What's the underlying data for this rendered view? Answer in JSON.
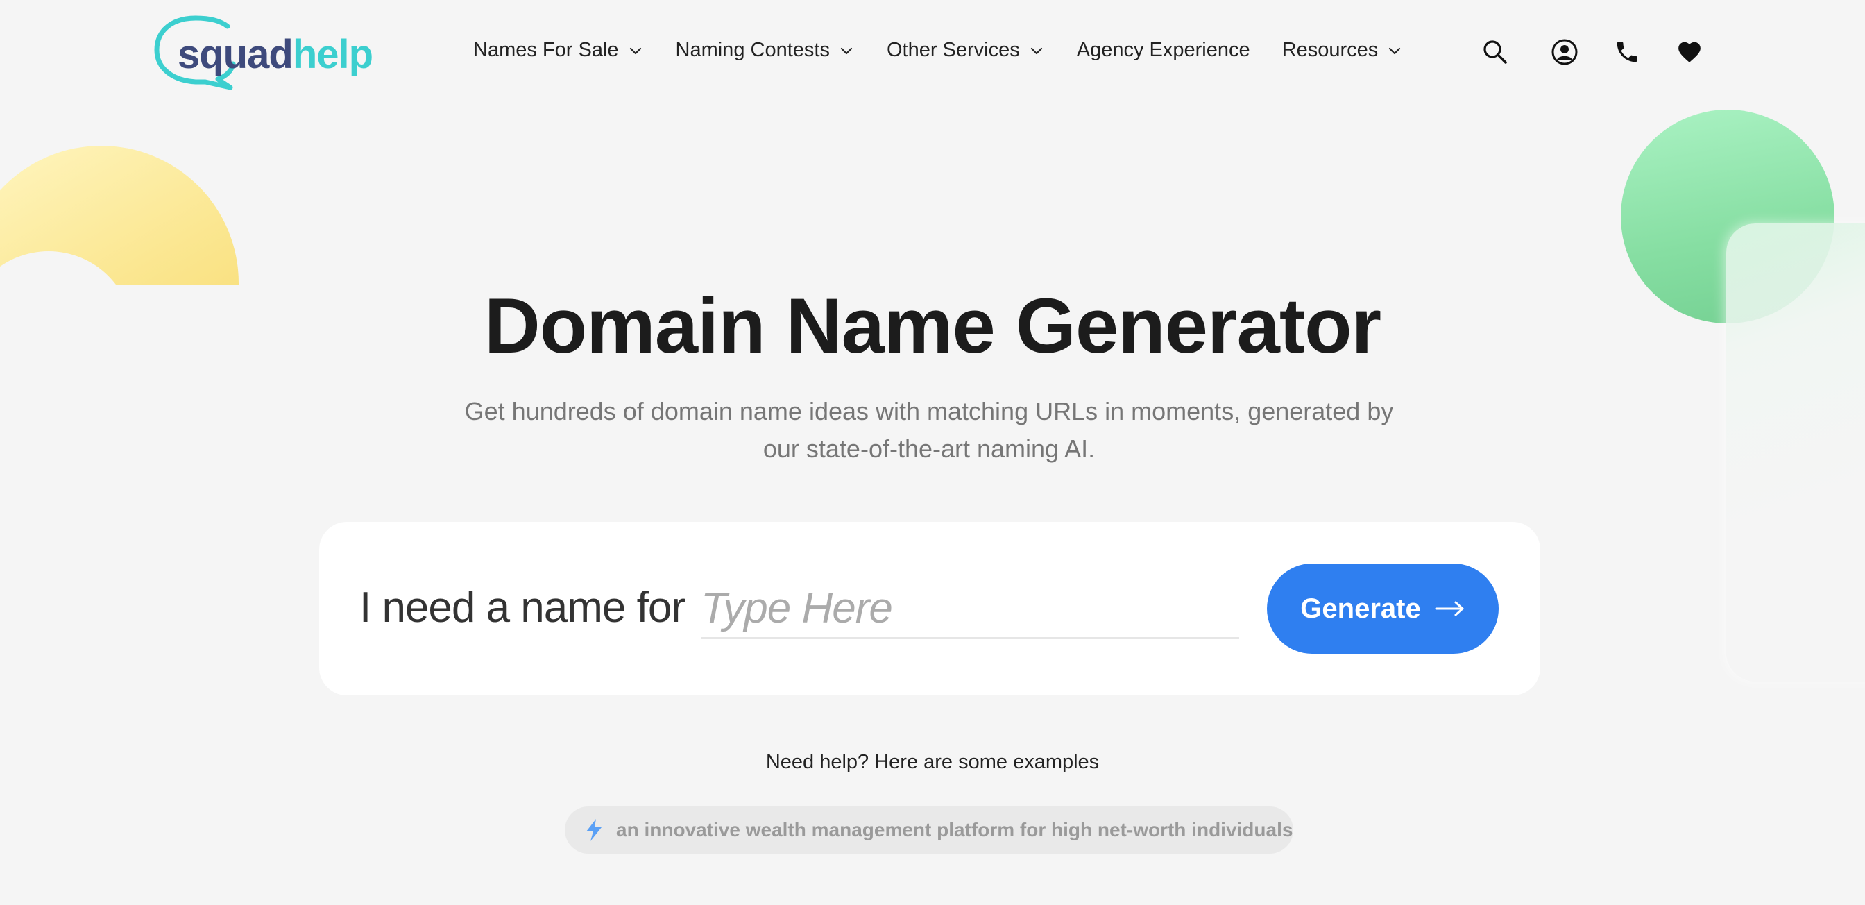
{
  "brand": {
    "logo_part1": "squad",
    "logo_part2": "help",
    "color_primary": "#3e4a7c",
    "color_accent": "#3ccfcf"
  },
  "nav": {
    "items": [
      {
        "label": "Names For Sale",
        "has_dropdown": true
      },
      {
        "label": "Naming Contests",
        "has_dropdown": true
      },
      {
        "label": "Other Services",
        "has_dropdown": true
      },
      {
        "label": "Agency Experience",
        "has_dropdown": false
      },
      {
        "label": "Resources",
        "has_dropdown": true
      }
    ]
  },
  "header_icons": [
    "search-icon",
    "user-account-icon",
    "phone-icon",
    "heart-icon"
  ],
  "hero": {
    "title": "Domain Name Generator",
    "subtitle": "Get hundreds of domain name ideas with matching URLs in moments, generated by our state-of-the-art naming AI."
  },
  "search": {
    "prefix": "I need a name for",
    "value": "",
    "placeholder": "Type Here",
    "button_label": "Generate"
  },
  "examples": {
    "help_text": "Need help? Here are some examples",
    "items": [
      "an innovative wealth management platform for high net-worth individuals"
    ]
  },
  "colors": {
    "button": "#2f7ff0",
    "background": "#f5f5f5"
  }
}
